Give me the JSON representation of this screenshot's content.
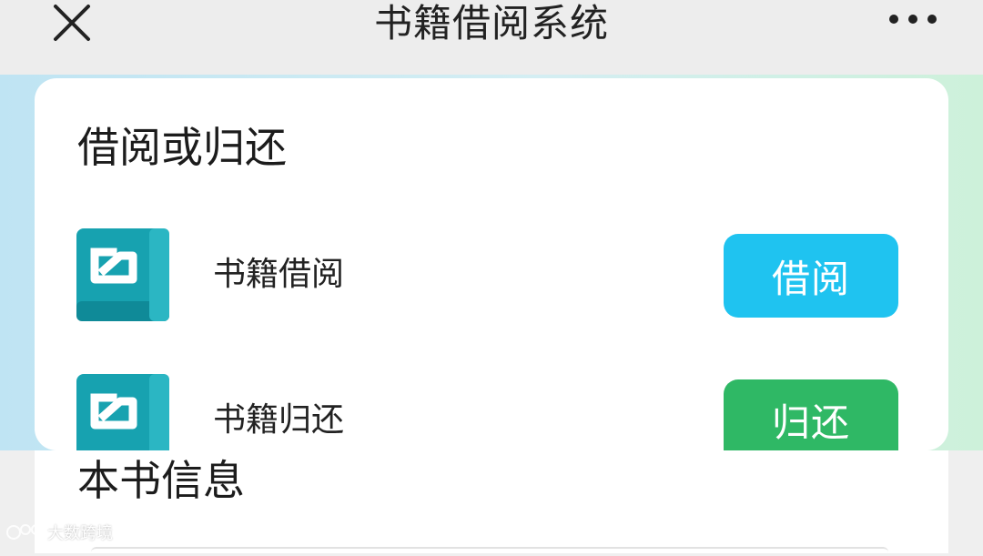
{
  "header": {
    "title": "书籍借阅系统",
    "close_icon": "close-icon",
    "more_icon": "more-dots-icon"
  },
  "borrow_section": {
    "title": "借阅或归还",
    "rows": [
      {
        "label": "书籍借阅",
        "button": "借阅",
        "button_color": "#1fc3f0",
        "icon": "book-icon"
      },
      {
        "label": "书籍归还",
        "button": "归还",
        "button_color": "#2fb865",
        "icon": "book-icon"
      }
    ]
  },
  "info_section": {
    "title": "本书信息"
  },
  "watermark": {
    "text": "大数跨境"
  },
  "colors": {
    "icon_teal": "#17a2b0",
    "icon_teal_dark": "#0f8a98"
  }
}
